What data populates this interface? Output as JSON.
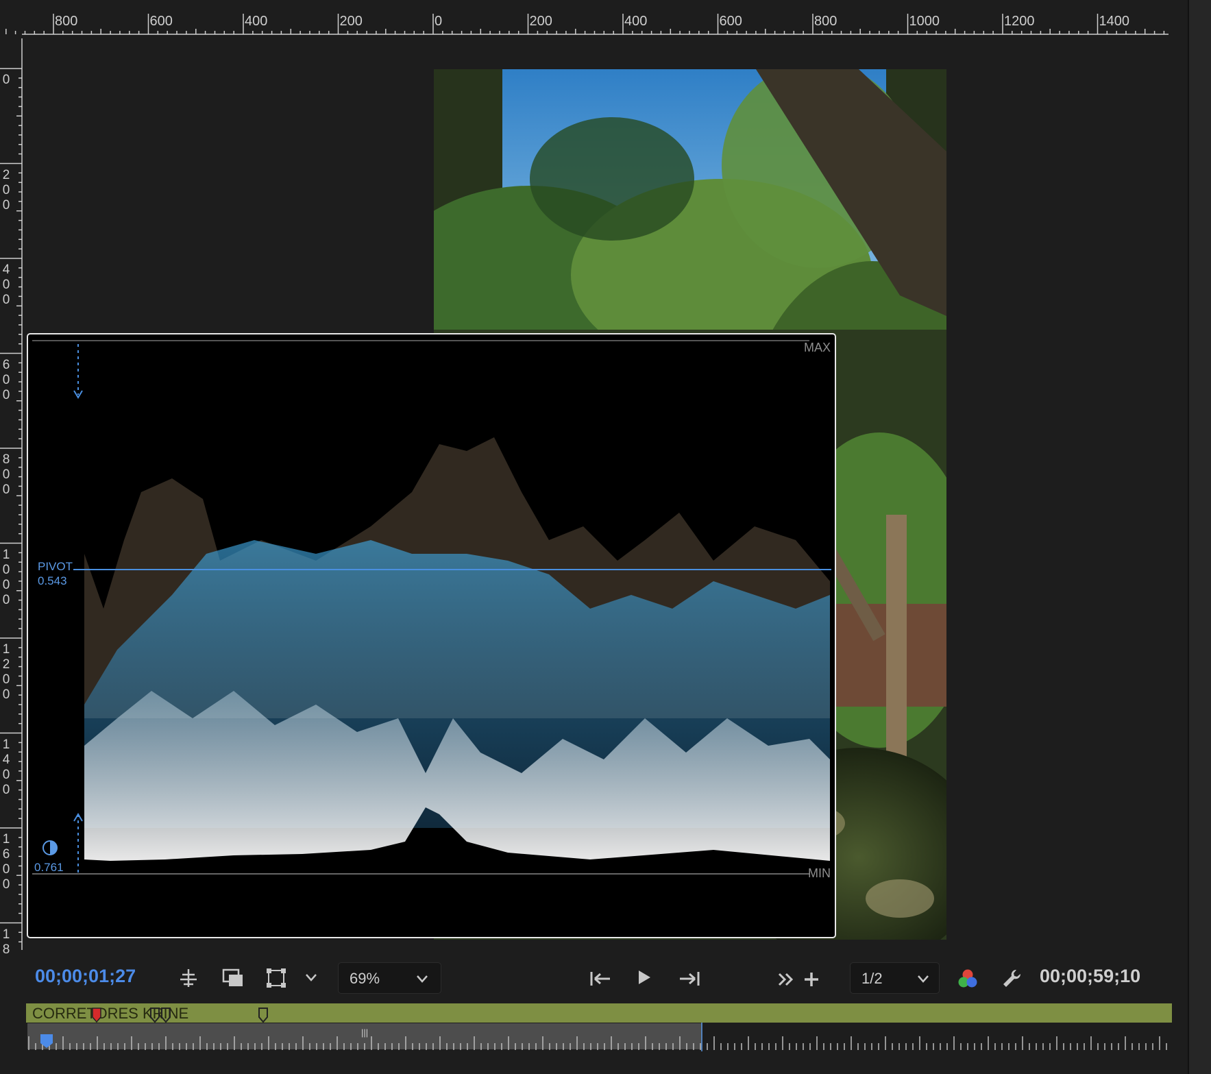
{
  "rulers": {
    "horizontal": [
      "800",
      "600",
      "400",
      "200",
      "0",
      "200",
      "400",
      "600",
      "800",
      "1000",
      "1200",
      "1400"
    ],
    "vertical": [
      [
        "0"
      ],
      [
        "2",
        "0",
        "0"
      ],
      [
        "4",
        "0",
        "0"
      ],
      [
        "6",
        "0",
        "0"
      ],
      [
        "8",
        "0",
        "0"
      ],
      [
        "1",
        "0",
        "0",
        "0"
      ],
      [
        "1",
        "2",
        "0",
        "0"
      ],
      [
        "1",
        "4",
        "0",
        "0"
      ],
      [
        "1",
        "6",
        "0",
        "0"
      ],
      [
        "1",
        "8"
      ]
    ]
  },
  "scope": {
    "max_label": "MAX",
    "min_label": "MIN",
    "pivot_label": "PIVOT",
    "pivot_value": "0.543",
    "contrast_value": "0.761"
  },
  "controls": {
    "current_timecode": "00;00;01;27",
    "zoom": "69%",
    "resolution": "1/2",
    "duration_timecode": "00;00;59;10"
  },
  "icons": {
    "marker": "add-marker-icon",
    "safe_margins": "safe-margins-icon",
    "transform": "transform-icon",
    "chevron": "chevron-down-icon",
    "step_back": "step-back-icon",
    "play": "play-icon",
    "step_forward": "step-forward-icon",
    "more": "more-controls-icon",
    "add": "add-button-icon",
    "color": "color-channels-icon",
    "settings": "wrench-icon"
  },
  "timeline": {
    "clip_name": "CORRETORES KRINE",
    "clip_color": "#7e8f43",
    "playhead_color": "#4c8be8"
  },
  "colors": {
    "accent_blue": "#5b9ae6",
    "panel_bg": "#1d1d1d"
  }
}
